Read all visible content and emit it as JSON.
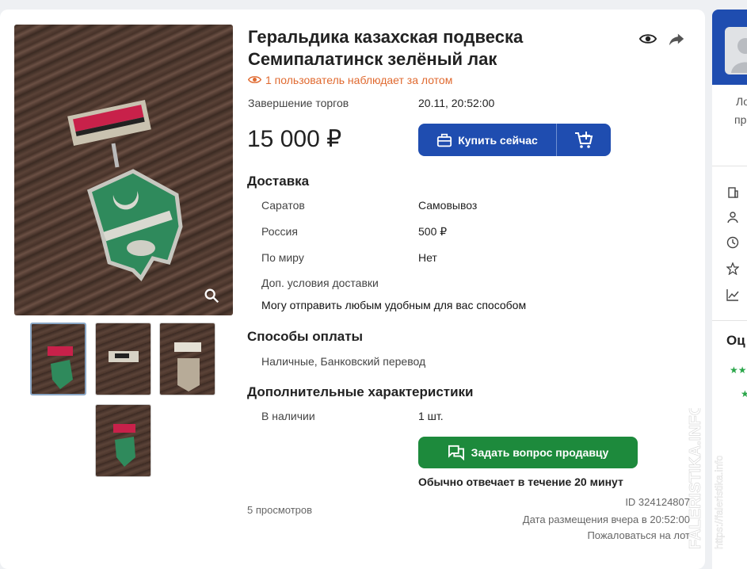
{
  "lot": {
    "title_line1": "Геральдика казахская подвеска",
    "title_line2": "Семипалатинск зелёный лак",
    "watchers_text": "1 пользователь наблюдает за лотом",
    "end_label": "Завершение торгов",
    "end_value": "20.11, 20:52:00",
    "price": "15 000 ₽",
    "buy_now_label": "Купить сейчас"
  },
  "delivery": {
    "title": "Доставка",
    "rows": [
      {
        "label": "Саратов",
        "value": "Самовывоз"
      },
      {
        "label": "Россия",
        "value": "500 ₽"
      },
      {
        "label": "По миру",
        "value": "Нет"
      }
    ],
    "extra_label": "Доп. условия доставки",
    "extra_text": "Могу отправить любым удобным для вас способом"
  },
  "payment": {
    "title": "Способы оплаты",
    "methods": "Наличные, Банковский перевод"
  },
  "characteristics": {
    "title": "Дополнительные характеристики",
    "stock_label": "В наличии",
    "stock_value": "1 шт."
  },
  "seller_contact": {
    "ask_label": "Задать вопрос продавцу",
    "reply_note": "Обычно отвечает в течение 20 минут"
  },
  "meta": {
    "views": "5 просмотров",
    "id": "ID 324124807",
    "posted": "Дата размещения вчера в 20:52:00",
    "report": "Пожаловаться на лот"
  },
  "right_panel": {
    "text1": "Ло",
    "text2": "пр",
    "section": "Оц"
  },
  "watermark": {
    "line1": "FALERISTIKA.INFO",
    "line2": "https://faleristika.info"
  },
  "colors": {
    "primary": "#1f4db0",
    "success": "#1d8a3c",
    "accent": "#e06a30"
  },
  "icons": [
    "zoom-icon",
    "eye-icon",
    "share-icon",
    "suitcase-icon",
    "cart-plus-icon",
    "chat-icon",
    "building-icon",
    "person-icon",
    "clock-icon",
    "star-icon",
    "chart-icon"
  ]
}
